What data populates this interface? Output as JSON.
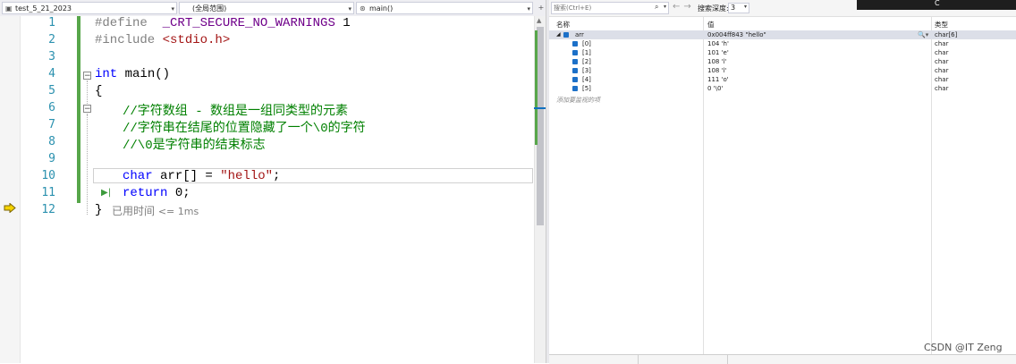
{
  "navbar": {
    "project": "test_5_21_2023",
    "scope": "(全局范围)",
    "function": "main()"
  },
  "editor": {
    "line_numbers": [
      "1",
      "2",
      "3",
      "4",
      "5",
      "6",
      "7",
      "8",
      "9",
      "10",
      "11",
      "12"
    ],
    "lines": {
      "l1_directive": "#define",
      "l1_macro": "_CRT_SECURE_NO_WARNINGS",
      "l1_value": "1",
      "l2_directive": "#include",
      "l2_header": "<stdio.h>",
      "l4_type": "int",
      "l4_name": "main()",
      "l5": "{",
      "l6": "//字符数组 - 数组是一组同类型的元素",
      "l7": "//字符串在结尾的位置隐藏了一个\\0的字符",
      "l8": "//\\0是字符串的结束标志",
      "l10_type": "char",
      "l10_decl": "arr[] =",
      "l10_str": "\"hello\"",
      "l10_end": ";",
      "l11_kw": "return",
      "l11_rest": "0;",
      "l12": "}"
    },
    "elapsed_prefix": "已用时间",
    "elapsed_value": "<= 1ms",
    "colors": {
      "comment": "#008000",
      "keyword": "#0000ff",
      "string": "#a31515",
      "linenum": "#2b91af",
      "changebar": "#57a64a"
    }
  },
  "watch": {
    "search_placeholder": "搜索(Ctrl+E)",
    "depth_label": "搜索深度:",
    "depth_value": "3",
    "corner_char": "C",
    "columns": {
      "name": "名称",
      "value": "值",
      "type": "类型"
    },
    "rows": [
      {
        "name": "arr",
        "value": "0x004ff843 \"hello\"",
        "type": "char[6]"
      },
      {
        "name": "[0]",
        "value": "104 'h'",
        "type": "char"
      },
      {
        "name": "[1]",
        "value": "101 'e'",
        "type": "char"
      },
      {
        "name": "[2]",
        "value": "108 'l'",
        "type": "char"
      },
      {
        "name": "[3]",
        "value": "108 'l'",
        "type": "char"
      },
      {
        "name": "[4]",
        "value": "111 'o'",
        "type": "char"
      },
      {
        "name": "[5]",
        "value": "0 '\\0'",
        "type": "char"
      }
    ],
    "add_item_hint": "添加要监视的项"
  },
  "watermark": "CSDN @IT Zeng"
}
